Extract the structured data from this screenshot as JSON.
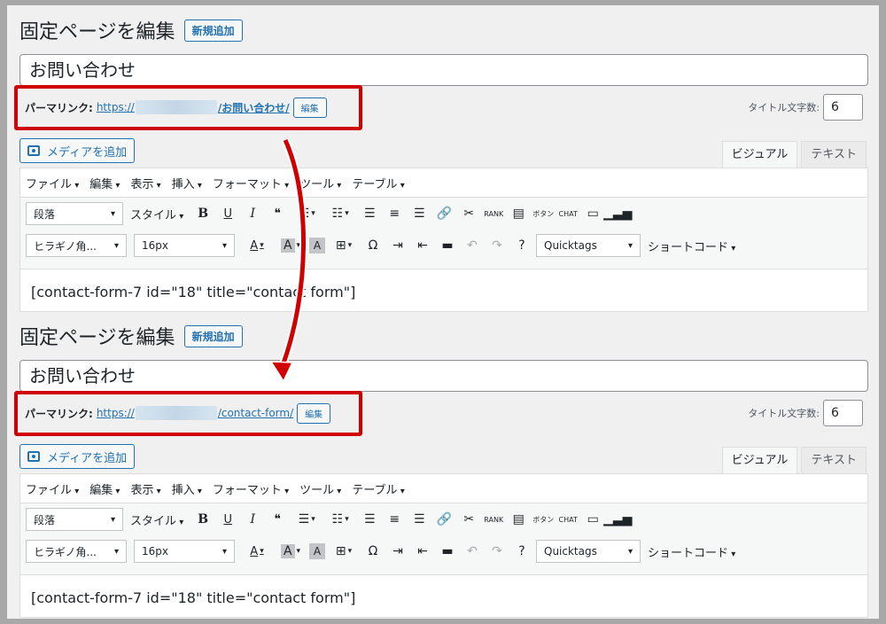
{
  "panels": [
    {
      "heading": "固定ページを編集",
      "add_new_label": "新規追加",
      "title_value": "お問い合わせ",
      "permalink_label": "パーマリンク:",
      "permalink_prefix": "https://",
      "permalink_slug": "/お問い合わせ/",
      "permalink_edit_label": "編集",
      "title_count_label": "タイトル文字数:",
      "title_count_value": "6",
      "media_button_label": "メディアを追加",
      "tabs": [
        "ビジュアル",
        "テキスト"
      ],
      "menubar": [
        "ファイル",
        "編集",
        "表示",
        "挿入",
        "フォーマット",
        "ツール",
        "テーブル"
      ],
      "toolbar": {
        "format_select": "段落",
        "style_label": "スタイル",
        "font_select": "ヒラギノ角...",
        "size_select": "16px",
        "quicktags_select": "Quicktags",
        "shortcode_label": "ショートコード"
      },
      "content": "[contact-form-7 id=\"18\" title=\"contact form\"]"
    },
    {
      "heading": "固定ページを編集",
      "add_new_label": "新規追加",
      "title_value": "お問い合わせ",
      "permalink_label": "パーマリンク:",
      "permalink_prefix": "https://",
      "permalink_slug": "/contact-form/",
      "permalink_edit_label": "編集",
      "title_count_label": "タイトル文字数:",
      "title_count_value": "6",
      "media_button_label": "メディアを追加",
      "tabs": [
        "ビジュアル",
        "テキスト"
      ],
      "menubar": [
        "ファイル",
        "編集",
        "表示",
        "挿入",
        "フォーマット",
        "ツール",
        "テーブル"
      ],
      "toolbar": {
        "format_select": "段落",
        "style_label": "スタイル",
        "font_select": "ヒラギノ角...",
        "size_select": "16px",
        "quicktags_select": "Quicktags",
        "shortcode_label": "ショートコード"
      },
      "content": "[contact-form-7 id=\"18\" title=\"contact form\"]"
    }
  ],
  "toolbar_icons": {
    "bold": "B",
    "underline": "U",
    "italic": "I",
    "quote": "❝",
    "omega": "Ω",
    "rank_badge": "RANK",
    "button_badge": "ボタン",
    "chat_badge": "CHAT"
  },
  "colors": {
    "highlight": "#d00000",
    "arrow": "#d00000",
    "link": "#2271b1"
  }
}
